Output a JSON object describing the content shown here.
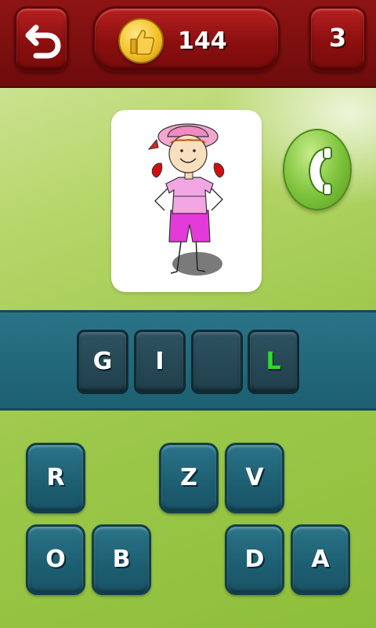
{
  "header": {
    "back_icon": "undo-arrow-icon",
    "coin_icon": "thumbs-up-coin-icon",
    "coins": "144",
    "level": "3"
  },
  "puzzle": {
    "picture": "girl-illustration",
    "hint_icon": "phone-icon"
  },
  "answer": {
    "slots": [
      "G",
      "I",
      "",
      "L"
    ],
    "revealed_color": "#2bdc2b"
  },
  "keyboard": {
    "row1": [
      "R",
      "Z",
      "V"
    ],
    "row2": [
      "O",
      "B",
      "D",
      "A"
    ]
  },
  "colors": {
    "header_red": "#8e1414",
    "band_teal": "#2a7386",
    "background_green": "#9dc84b"
  }
}
